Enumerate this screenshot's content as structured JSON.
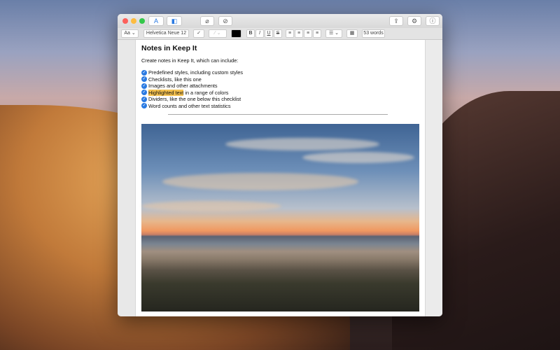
{
  "toolbar": {
    "font_style": "Aa",
    "font": "Helvetica Neue 12",
    "bold": "B",
    "italic": "I",
    "underline": "U",
    "strike": "S",
    "word_count": "53 words"
  },
  "note": {
    "title": "Notes in Keep It",
    "intro": "Create notes in Keep It, which can include:",
    "checklist": [
      {
        "text": "Predefined styles, including custom styles"
      },
      {
        "text": "Checklists, like this one"
      },
      {
        "text": "Images and other attachments"
      },
      {
        "highlight": "Highlighted text",
        "text": " in a range of colors"
      },
      {
        "text": "Dividers, like the one below this checklist"
      },
      {
        "text": "Word counts and other text statistics"
      }
    ]
  },
  "colors": {
    "highlight": "#f6c24f",
    "check": "#2a7ae2",
    "text_color": "#000000"
  }
}
